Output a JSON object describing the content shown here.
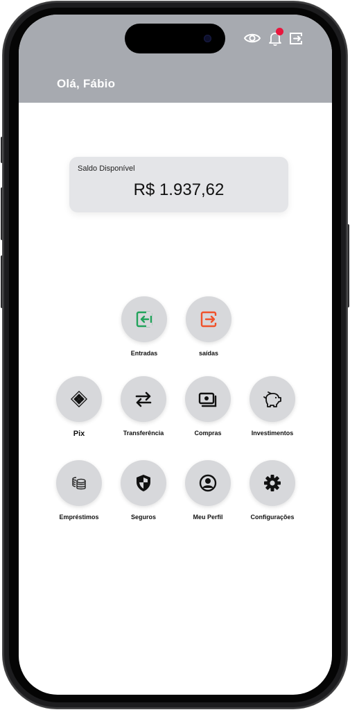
{
  "header": {
    "greeting": "Olá, Fábio",
    "icons": [
      "eye-icon",
      "bell-icon",
      "logout-icon"
    ],
    "background": "#a7aab0"
  },
  "balance": {
    "label": "Saldo Disponível",
    "value": "R$ 1.937,62"
  },
  "actions": {
    "entradas": {
      "label": "Entradas",
      "icon": "login-icon",
      "color": "#21a35b"
    },
    "saidas": {
      "label": "saídas",
      "icon": "logout-icon",
      "color": "#f0522a"
    },
    "pix": {
      "label": "Pix",
      "icon": "pix-icon"
    },
    "transferencia": {
      "label": "Transferência",
      "icon": "transfer-arrows-icon"
    },
    "compras": {
      "label": "Compras",
      "icon": "money-icon"
    },
    "investimentos": {
      "label": "Investimentos",
      "icon": "piggy-bank-icon"
    },
    "emprestimos": {
      "label": "Empréstimos",
      "icon": "coins-icon"
    },
    "seguros": {
      "label": "Seguros",
      "icon": "shield-icon"
    },
    "perfil": {
      "label": "Meu Perfil",
      "icon": "user-circle-icon"
    },
    "configuracoes": {
      "label": "Configurações",
      "icon": "gear-icon"
    }
  }
}
